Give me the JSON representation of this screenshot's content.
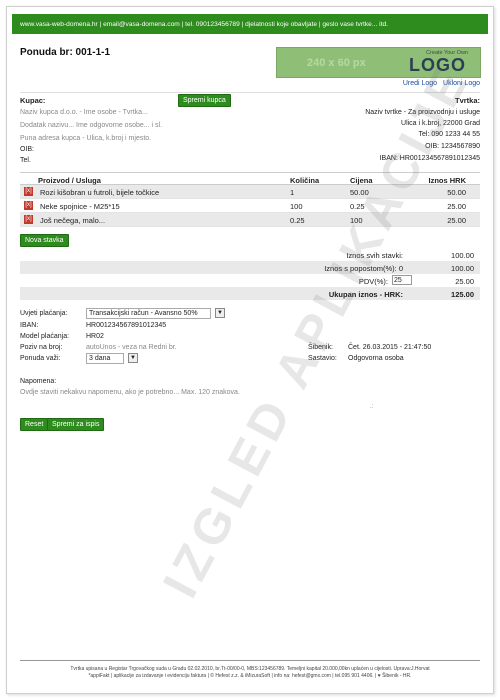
{
  "topbar": "www.vasa-web-domena.hr | email@vasa-domena.com | tel. 090123456789 | djelatnosti koje obavljate | geslo vase tvrtke... itd.",
  "title": "Ponuda br: 001-1-1",
  "logo": {
    "size_text": "240 x 60 px",
    "create_text": "Create Your Own",
    "logo_text": "LOGO",
    "upload_link": "Uredi Logo",
    "remove_link": "Ukloni Logo"
  },
  "customer": {
    "label": "Kupac:",
    "save_button": "Spremi kupca",
    "name": "Naziv kupca d.o.o. - Ime osobe - Tvrtka...",
    "extra": "Dodatak nazivu... Ime odgovorne osobe... i sl.",
    "address": "Puna adresa kupca - Ulica, k.broj i mjesto.",
    "oib_label": "OIB:",
    "tel_label": "Tel."
  },
  "company": {
    "label": "Tvrtka:",
    "name": "Naziv tvrtke - Za proizvodnju i usluge",
    "address": "Ulica i k.broj, 22000 Grad",
    "tel": "Tel: 090 1233 44 55",
    "oib": "OIB: 1234567890",
    "iban": "IBAN: HR001234567891012345"
  },
  "table": {
    "headers": [
      "Proizvod / Usluga",
      "Količina",
      "Cijena",
      "Iznos HRK"
    ],
    "rows": [
      {
        "name": "Rozi kišobran u futroli, bijele točkice",
        "qty": "1",
        "price": "50.00",
        "total": "50.00"
      },
      {
        "name": "Neke spojnice - M25*15",
        "qty": "100",
        "price": "0.25",
        "total": "25.00"
      },
      {
        "name": "Još nečega, malo...",
        "qty": "0.25",
        "price": "100",
        "total": "25.00"
      }
    ],
    "delete_label": "[x]",
    "new_item_button": "Nova stavka"
  },
  "totals": {
    "sum_label": "Iznos svih stavki:",
    "sum_value": "100.00",
    "discount_label": "Iznos s popostom(%): 0",
    "discount_value": "100.00",
    "pdv_label": "PDV(%):",
    "pdv_input": "25",
    "pdv_value": "25.00",
    "grand_label": "Ukupan iznos - HRK:",
    "grand_value": "125.00"
  },
  "info": {
    "payment_label": "Uvjeti plaćanja:",
    "payment_value": "Transakcijski račun - Avansno 50%",
    "iban_label": "IBAN:",
    "iban_value": "HR001234567891012345",
    "model_label": "Model plaćanja:",
    "model_value": "HR02",
    "ref_label": "Poziv na broj:",
    "ref_value": "autoUnos - veza na Redni br.",
    "valid_label": "Ponuda važi:",
    "valid_value": "3 dana",
    "place_label": "Šibenik:",
    "place_value": "Čet. 26.03.2015 - 21:47:50",
    "author_label": "Sastavio:",
    "author_value": "Odgovorna osoba",
    "note_label": "Napomena:",
    "note_value": "Ovdje staviti nekakvu napomenu, ako je potrebno... Max. 120 znakova."
  },
  "buttons": {
    "reset": "Reset",
    "save_print": "Spremi za ispis"
  },
  "watermark": "IZGLED APLIKACIJE",
  "footer": {
    "line1": "Tvrtka upisana u Registar Trgovačkog suda u Gradu 02.02.2010, br.Tt-00/00-0, MBS:123456789. Temeljni kapital 20.000,00kn uplaćen u cijelosti. Uprava:J.Horvat",
    "line2": "*appiFakt | aplikacije za izdavanje i evidenciju faktura | © Hefest z.z. & iMizuraSoft | info na: hefest@gmx.com | tel.095 901 4406. | ♥ Šibenik - HR."
  },
  "colors": {
    "accent": "#2e8b1e",
    "delete": "#c0392b",
    "link": "#1a4a9a"
  }
}
